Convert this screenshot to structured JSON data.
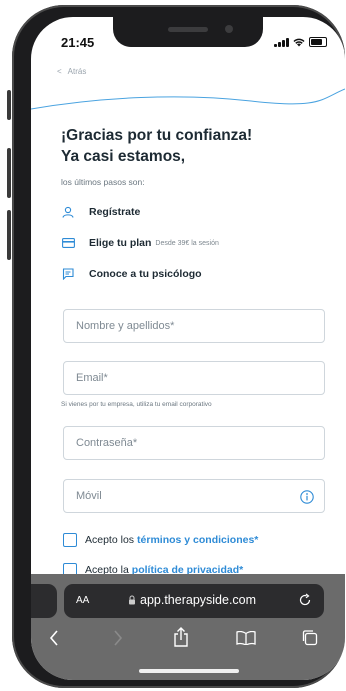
{
  "status_bar": {
    "time": "21:45"
  },
  "nav": {
    "back_label": "Atrás"
  },
  "heading": {
    "line1": "¡Gracias por tu confianza!",
    "line2": "Ya casi estamos,"
  },
  "subtitle": "los últimos pasos son:",
  "steps": [
    {
      "label": "Regístrate",
      "note": "",
      "icon": "user-icon"
    },
    {
      "label": "Elige tu plan",
      "note": "Desde 39€ la sesión",
      "icon": "card-icon"
    },
    {
      "label": "Conoce a tu psicólogo",
      "note": "",
      "icon": "chat-icon"
    }
  ],
  "form": {
    "name_placeholder": "Nombre y apellidos*",
    "email_placeholder": "Email*",
    "email_hint": "Si vienes por tu empresa, utiliza tu email corporativo",
    "password_placeholder": "Contraseña*",
    "phone_placeholder": "Móvil",
    "terms_prefix": "Acepto los",
    "terms_link": "términos y condiciones*",
    "privacy_prefix": "Acepto la",
    "privacy_link": "política de privacidad*"
  },
  "browser": {
    "aa_label": "AA",
    "url": "app.therapyside.com"
  },
  "colors": {
    "accent": "#2e8bd6",
    "text": "#1d2a33",
    "browser_bar": "#6b6b6b"
  }
}
